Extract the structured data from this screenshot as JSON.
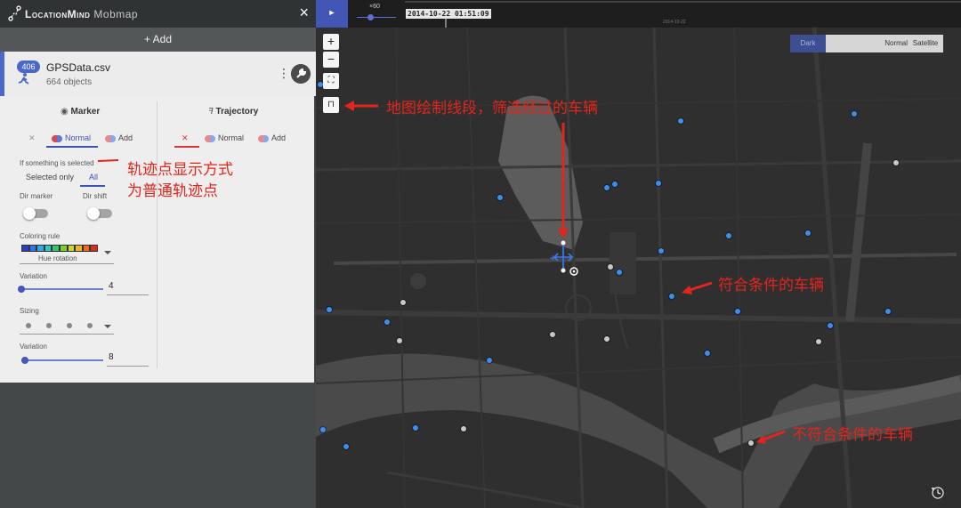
{
  "header": {
    "brand": "LocationMind",
    "app": "Mobmap",
    "close_icon": "×"
  },
  "add_bar": {
    "label": "+ Add"
  },
  "layer": {
    "badge": "406",
    "name": "GPSData.csv",
    "count": "664 objects",
    "menu_icon": "⋮"
  },
  "marker": {
    "title": "Marker",
    "mode_none": "✕",
    "mode_normal": "Normal",
    "mode_add": "Add",
    "selected_label": "If something is selected",
    "selected_only": "Selected only",
    "selected_all": "All",
    "dir_marker": "Dir marker",
    "dir_shift": "Dir shift",
    "coloring_rule": "Coloring rule",
    "coloring_value": "Hue rotation",
    "variation_label": "Variation",
    "variation_value": "4",
    "sizing_label": "Sizing",
    "variation2_label": "Variation",
    "variation2_value": "8",
    "coloring_colors": [
      "#2740c8",
      "#2f74e0",
      "#2fa8e8",
      "#30c9c0",
      "#36c36e",
      "#7ccd34",
      "#c9d72a",
      "#f0b22a",
      "#ec6a22",
      "#d62d1e"
    ]
  },
  "trajectory": {
    "title": "Trajectory",
    "mode_none": "✕",
    "mode_normal": "Normal",
    "mode_add": "Add"
  },
  "map": {
    "play_icon": "►",
    "speed": "×60",
    "time": "2014-10-22 01:51:09",
    "timeline_date": "2014-10-22",
    "zoom_in": "+",
    "zoom_out": "−",
    "style_dark": "Dark",
    "style_normal": "Normal",
    "style_satellite": "Satellite"
  },
  "annotations": {
    "draw_segment": "地图绘制线段，筛选经过的车辆",
    "marker_mode_line1": "轨迹点显示方式",
    "marker_mode_line2": "为普通轨迹点",
    "matching": "符合条件的车辆",
    "not_matching": "不符合条件的车辆"
  },
  "colors": {
    "accent": "#4256b6",
    "match_dot": "#3b8ff0",
    "nonmatch_dot": "#c8c8c8",
    "annotation": "#e3251c"
  }
}
